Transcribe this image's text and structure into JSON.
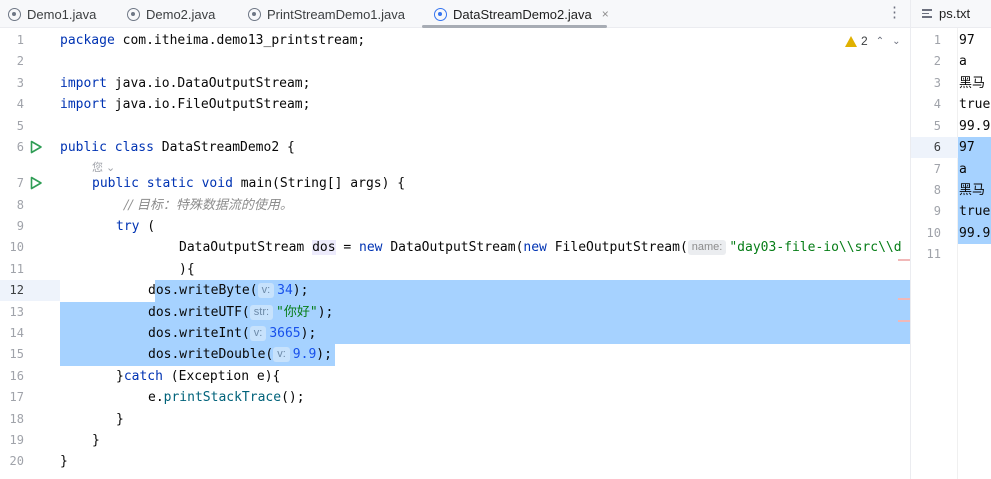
{
  "tabs": [
    {
      "label": "Demo1.java",
      "active": false
    },
    {
      "label": "Demo2.java",
      "active": false
    },
    {
      "label": "PrintStreamDemo1.java",
      "active": false
    },
    {
      "label": "DataStreamDemo2.java",
      "active": true
    }
  ],
  "tab_close_glyph": "×",
  "tab_menu_glyph": "⋮",
  "warnings": {
    "count": "2",
    "up": "⌃",
    "down": "⌄"
  },
  "author_hint": "您 ⌄",
  "editor": {
    "current_line": 12,
    "selected_lines": [
      12,
      13,
      14,
      15
    ],
    "line_numbers": [
      "1",
      "2",
      "3",
      "4",
      "5",
      "6",
      "7",
      "8",
      "9",
      "10",
      "11",
      "12",
      "13",
      "14",
      "15",
      "16",
      "17",
      "18",
      "19",
      "20"
    ]
  },
  "code": {
    "l1": {
      "kw": "package",
      "rest": " com.itheima.demo13_printstream;"
    },
    "l3": {
      "kw": "import",
      "rest": " java.io.DataOutputStream;"
    },
    "l4": {
      "kw": "import",
      "rest": " java.io.FileOutputStream;"
    },
    "l6": {
      "kw1": "public",
      "kw2": "class",
      "rest": " DataStreamDemo2 {"
    },
    "l7": {
      "kw1": "public",
      "kw2": "static",
      "kw3": "void",
      "rest": " main(String[] args) {"
    },
    "l8": {
      "comment": "// 目标：特殊数据流的使用。"
    },
    "l9": {
      "kw": "try",
      "rest": " ("
    },
    "l10": {
      "type": "DataOutputStream ",
      "var": "dos",
      "eq": " = ",
      "kw1": "new",
      "mid": " DataOutputStream(",
      "kw2": "new",
      "mid2": " FileOutputStream(",
      "hint": "name:",
      "str": "\"day03-file-io\\\\src\\\\d"
    },
    "l11": {
      "rest": "){"
    },
    "l12": {
      "var": "dos",
      "call": ".writeByte(",
      "hint": "v:",
      "val": "34",
      "end": ");"
    },
    "l13": {
      "var": "dos",
      "call": ".writeUTF(",
      "hint": "str:",
      "val": "\"你好\"",
      "end": ");"
    },
    "l14": {
      "var": "dos",
      "call": ".writeInt(",
      "hint": "v:",
      "val": "3665",
      "end": ");"
    },
    "l15": {
      "var": "dos",
      "call": ".writeDouble(",
      "hint": "v:",
      "val": "9.9",
      "end": ");"
    },
    "l16": {
      "pre": "}",
      "kw": "catch",
      "rest": " (Exception e){"
    },
    "l17": {
      "pre": "e.",
      "meth": "printStackTrace",
      "rest": "();"
    },
    "l18": {
      "rest": "}"
    },
    "l19": {
      "rest": "}"
    },
    "l20": {
      "rest": "}"
    }
  },
  "right_panel": {
    "tab_label": "ps.txt",
    "lines": [
      {
        "n": "1",
        "text": "97"
      },
      {
        "n": "2",
        "text": "a"
      },
      {
        "n": "3",
        "text": "黑马"
      },
      {
        "n": "4",
        "text": "true"
      },
      {
        "n": "5",
        "text": "99.9"
      },
      {
        "n": "6",
        "text": "97"
      },
      {
        "n": "7",
        "text": "a"
      },
      {
        "n": "8",
        "text": "黑马"
      },
      {
        "n": "9",
        "text": "true"
      },
      {
        "n": "10",
        "text": "99.9"
      },
      {
        "n": "11",
        "text": ""
      }
    ]
  },
  "colors": {
    "selection": "#a6d2ff",
    "keyword": "#0033b3",
    "string": "#067d17",
    "number": "#1750eb",
    "run_icon": "#2f9d55",
    "warning": "#e0b100"
  }
}
